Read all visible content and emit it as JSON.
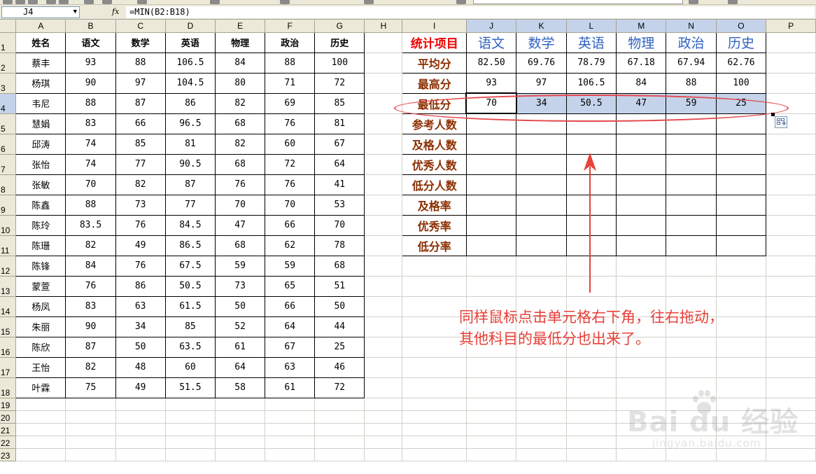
{
  "formula_bar": {
    "cell_ref": "J4",
    "fx_label": "fx",
    "formula": "=MIN(B2:B18)"
  },
  "columns": [
    "A",
    "B",
    "C",
    "D",
    "E",
    "F",
    "G",
    "H",
    "I",
    "J",
    "K",
    "L",
    "M",
    "N",
    "O",
    "P"
  ],
  "selected_columns": [
    "J",
    "K",
    "L",
    "M",
    "N",
    "O"
  ],
  "rows": [
    "1",
    "2",
    "3",
    "4",
    "5",
    "6",
    "7",
    "8",
    "9",
    "10",
    "11",
    "12",
    "13",
    "14",
    "15",
    "16",
    "17",
    "18",
    "19",
    "20",
    "21",
    "22",
    "23"
  ],
  "scores": {
    "headers": [
      "姓名",
      "语文",
      "数学",
      "英语",
      "物理",
      "政治",
      "历史"
    ],
    "records": [
      [
        "蔡丰",
        "93",
        "88",
        "106.5",
        "84",
        "88",
        "100"
      ],
      [
        "杨琪",
        "90",
        "97",
        "104.5",
        "80",
        "71",
        "72"
      ],
      [
        "韦尼",
        "88",
        "87",
        "86",
        "82",
        "69",
        "85"
      ],
      [
        "慧娟",
        "83",
        "66",
        "96.5",
        "68",
        "76",
        "81"
      ],
      [
        "邱涛",
        "74",
        "85",
        "81",
        "82",
        "60",
        "67"
      ],
      [
        "张怡",
        "74",
        "77",
        "90.5",
        "68",
        "72",
        "64"
      ],
      [
        "张敏",
        "70",
        "82",
        "87",
        "76",
        "76",
        "41"
      ],
      [
        "陈鑫",
        "88",
        "73",
        "77",
        "70",
        "70",
        "53"
      ],
      [
        "陈玲",
        "83.5",
        "76",
        "84.5",
        "47",
        "66",
        "70"
      ],
      [
        "陈珊",
        "82",
        "49",
        "86.5",
        "68",
        "62",
        "78"
      ],
      [
        "陈锋",
        "84",
        "76",
        "67.5",
        "59",
        "59",
        "68"
      ],
      [
        "蒙萱",
        "76",
        "86",
        "50.5",
        "73",
        "65",
        "51"
      ],
      [
        "杨凤",
        "83",
        "63",
        "61.5",
        "50",
        "66",
        "50"
      ],
      [
        "朱丽",
        "90",
        "34",
        "85",
        "52",
        "64",
        "44"
      ],
      [
        "陈欣",
        "87",
        "50",
        "63.5",
        "61",
        "67",
        "25"
      ],
      [
        "王怡",
        "82",
        "48",
        "60",
        "64",
        "63",
        "46"
      ],
      [
        "叶霖",
        "75",
        "49",
        "51.5",
        "58",
        "61",
        "72"
      ]
    ]
  },
  "stats": {
    "title": "统计项目",
    "subjects": [
      "语文",
      "数学",
      "英语",
      "物理",
      "政治",
      "历史"
    ],
    "rows": [
      {
        "label": "平均分",
        "values": [
          "82.50",
          "69.76",
          "78.79",
          "67.18",
          "67.94",
          "62.76"
        ]
      },
      {
        "label": "最高分",
        "values": [
          "93",
          "97",
          "106.5",
          "84",
          "88",
          "100"
        ]
      },
      {
        "label": "最低分",
        "values": [
          "70",
          "34",
          "50.5",
          "47",
          "59",
          "25"
        ]
      },
      {
        "label": "参考人数",
        "values": [
          "",
          "",
          "",
          "",
          "",
          ""
        ]
      },
      {
        "label": "及格人数",
        "values": [
          "",
          "",
          "",
          "",
          "",
          ""
        ]
      },
      {
        "label": "优秀人数",
        "values": [
          "",
          "",
          "",
          "",
          "",
          ""
        ]
      },
      {
        "label": "低分人数",
        "values": [
          "",
          "",
          "",
          "",
          "",
          ""
        ]
      },
      {
        "label": "及格率",
        "values": [
          "",
          "",
          "",
          "",
          "",
          ""
        ]
      },
      {
        "label": "优秀率",
        "values": [
          "",
          "",
          "",
          "",
          "",
          ""
        ]
      },
      {
        "label": "低分率",
        "values": [
          "",
          "",
          "",
          "",
          "",
          ""
        ]
      }
    ]
  },
  "annotation": {
    "line1": "同样鼠标点击单元格右下角，往右拖动，",
    "line2": "其他科目的最低分也出来了。"
  },
  "watermark": {
    "logo": "Bai du 经验",
    "url": "jingyan.baidu.com"
  },
  "colors": {
    "accent_red": "#e8403a",
    "subject_blue": "#2f62c0",
    "label_brown": "#8b2e00",
    "selection_blue": "#c5d3ea"
  }
}
